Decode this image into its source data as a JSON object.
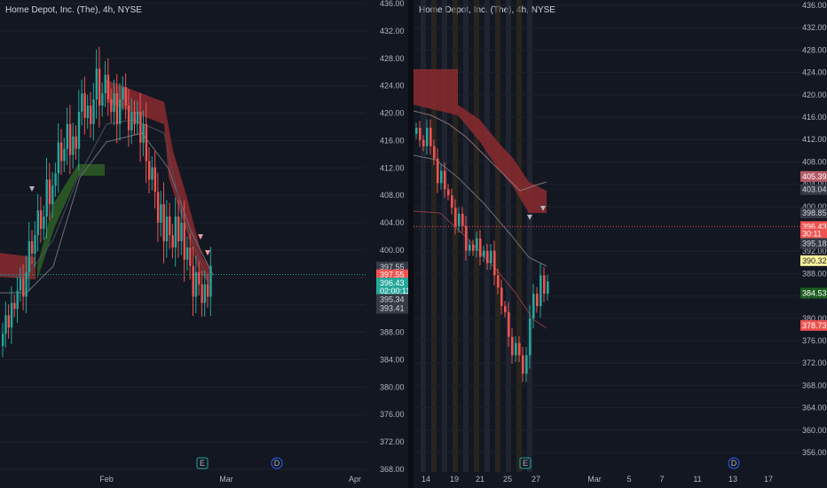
{
  "colors": {
    "bg": "#131722",
    "up": "#26a69a",
    "down": "#ef5350",
    "cloud_red": "#8b2a2f",
    "cloud_green": "#2e5a25",
    "grid": "#1e222d",
    "line": "#6b6f78"
  },
  "left": {
    "symbol": "Home Depot, Inc. (The), 4h, NYSE",
    "price_axis": [
      "436.00",
      "432.00",
      "428.00",
      "424.00",
      "420.00",
      "416.00",
      "412.00",
      "408.00",
      "404.00",
      "400.00",
      "396.00",
      "392.00",
      "388.00",
      "384.00",
      "380.00",
      "376.00",
      "372.00",
      "368.00"
    ],
    "time_axis": [
      "Feb",
      "Mar",
      "Apr"
    ],
    "markers": [
      "E",
      "D"
    ],
    "tags": [
      {
        "text": "397.55",
        "price": 397.55,
        "style": "gray"
      },
      {
        "text": "397.55",
        "price": 396.4,
        "style": "red"
      },
      {
        "text": "396.43",
        "price": 395.2,
        "style": "green-top"
      },
      {
        "text": "02:00:11",
        "price": 394.0,
        "style": "green-bottom"
      },
      {
        "text": "395.34",
        "price": 392.8,
        "style": "gray"
      },
      {
        "text": "393.41",
        "price": 391.5,
        "style": "gray"
      }
    ]
  },
  "right": {
    "symbol": "Home Depot, Inc. (The), 4h, NYSE",
    "price_axis": [
      "436.00",
      "432.00",
      "428.00",
      "424.00",
      "420.00",
      "416.00",
      "412.00",
      "408.00",
      "404.00",
      "400.00",
      "396.00",
      "392.00",
      "388.00",
      "384.00",
      "380.00",
      "376.00",
      "372.00",
      "368.00",
      "364.00",
      "360.00",
      "356.00"
    ],
    "time_axis": [
      "14",
      "19",
      "21",
      "25",
      "27",
      "Mar",
      "5",
      "7",
      "11",
      "13",
      "17"
    ],
    "markers": [
      "E",
      "D"
    ],
    "tags": [
      {
        "text": "405.39",
        "price": 405.39,
        "style": "pink"
      },
      {
        "text": "403.04",
        "price": 403.04,
        "style": "gray"
      },
      {
        "text": "398.85",
        "price": 398.85,
        "style": "gray"
      },
      {
        "text": "396.43",
        "price": 396.43,
        "style": "red-top"
      },
      {
        "text": "30:11",
        "price": 395.1,
        "style": "red-bottom"
      },
      {
        "text": "395.18",
        "price": 393.4,
        "style": "gray"
      },
      {
        "text": "390.32",
        "price": 390.32,
        "style": "yellow"
      },
      {
        "text": "384.53",
        "price": 384.53,
        "style": "green"
      },
      {
        "text": "378.73",
        "price": 378.73,
        "style": "red"
      }
    ]
  }
}
